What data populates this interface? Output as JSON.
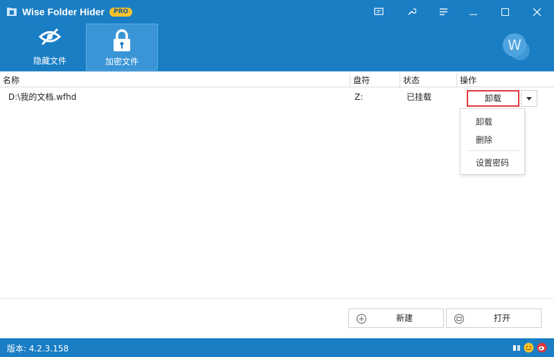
{
  "app": {
    "title": "Wise Folder Hider",
    "badge": "PRO"
  },
  "toolbar": {
    "tools": [
      {
        "label": "隐藏文件",
        "icon": "hidden-eye-icon"
      },
      {
        "label": "加密文件",
        "icon": "lock-icon",
        "active": true
      }
    ],
    "avatar_letter": "W"
  },
  "table": {
    "columns": [
      "名称",
      "盘符",
      "状态",
      "操作"
    ],
    "rows": [
      {
        "name": "D:\\我的文档.wfhd",
        "drive": "Z:",
        "status": "已挂载",
        "action": "卸载"
      }
    ]
  },
  "dropdown": {
    "items": [
      "卸载",
      "删除",
      "设置密码"
    ]
  },
  "actions": {
    "new_label": "新建",
    "open_label": "打开"
  },
  "statusbar": {
    "version": "版本: 4.2.3.158"
  },
  "colors": {
    "accent": "#1a7ec4",
    "highlight": "#e0373b",
    "badge": "#f5c12e"
  }
}
